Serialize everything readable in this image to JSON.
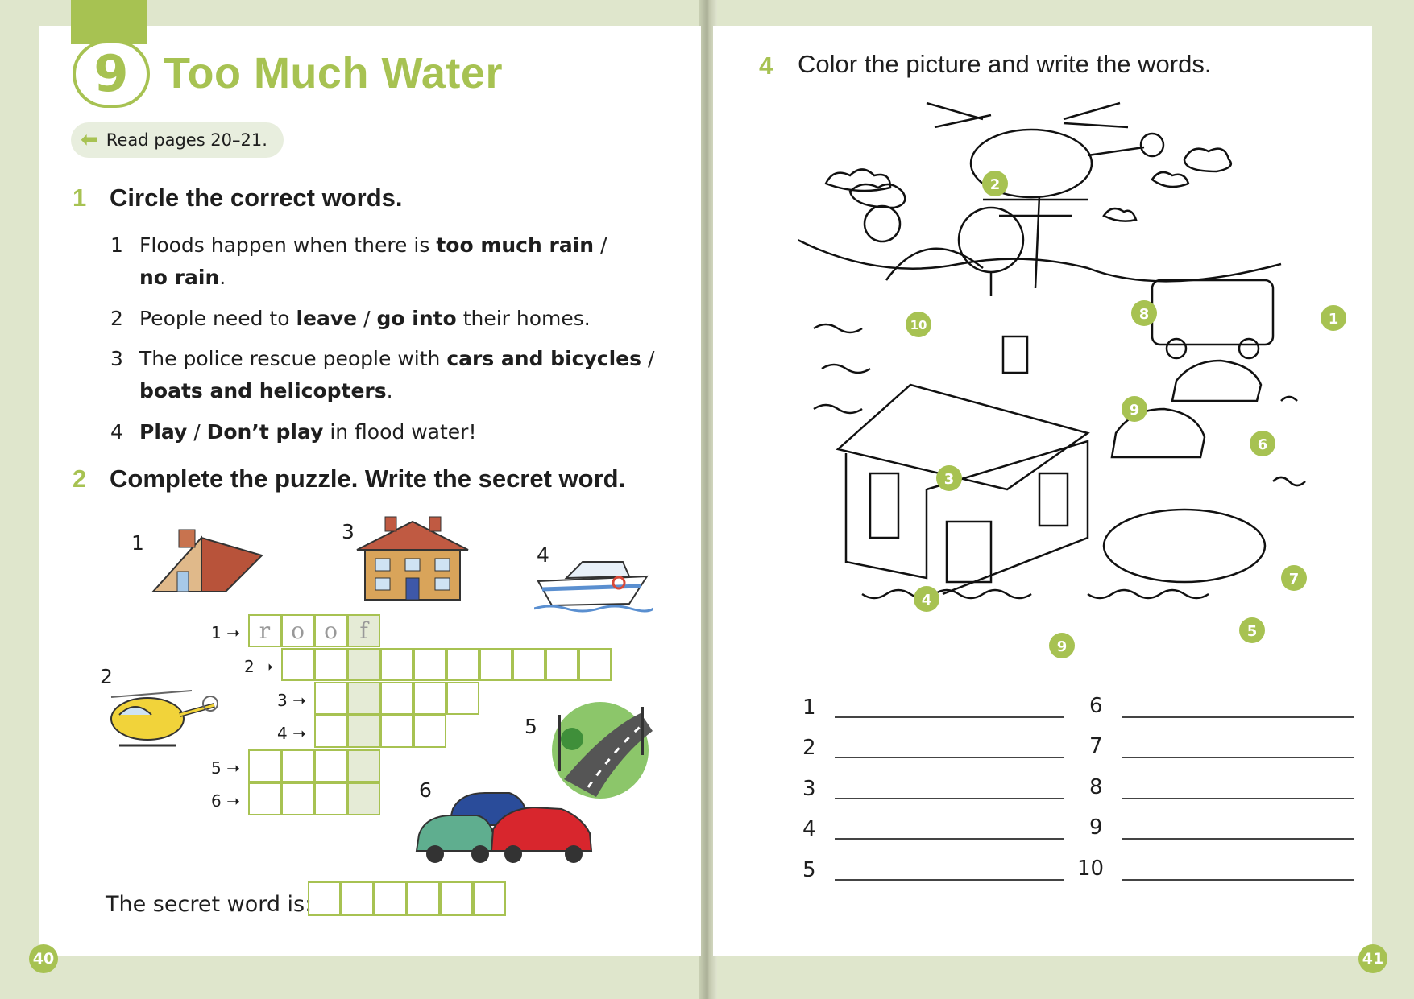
{
  "left": {
    "unit_number": "9",
    "title": "Too Much Water",
    "read_pages": "Read pages 20–21.",
    "page_number": "40",
    "ex1": {
      "number": "1",
      "heading": "Circle the correct words.",
      "items": [
        {
          "n": "1",
          "lines": [
            [
              "Floods happen when there is ",
              "too much rain",
              " /"
            ],
            [
              "",
              "no rain",
              "."
            ]
          ]
        },
        {
          "n": "2",
          "lines": [
            [
              "People need to ",
              "leave",
              " / "
            ],
            [
              "",
              "go into",
              " their homes."
            ]
          ]
        },
        {
          "n": "3",
          "lines": [
            [
              "The police rescue people with ",
              "cars and bicycles",
              " /"
            ],
            [
              "",
              "boats and helicopters",
              "."
            ]
          ]
        },
        {
          "n": "4",
          "lines": [
            [
              "",
              "Play",
              " / "
            ],
            [
              "",
              "Don’t play",
              " in flood water!"
            ]
          ]
        }
      ]
    },
    "ex2": {
      "number": "2",
      "heading": "Complete the puzzle. Write the secret word.",
      "picture_labels": [
        "1",
        "2",
        "3",
        "4",
        "5",
        "6"
      ],
      "row_labels": [
        "1",
        "2",
        "3",
        "4",
        "5",
        "6"
      ],
      "example_letters": [
        "r",
        "o",
        "o",
        "f"
      ],
      "secret_label": "The secret word is:"
    }
  },
  "right": {
    "ex4": {
      "number": "4",
      "heading": "Color the picture and write the words."
    },
    "picture_markers": [
      "1",
      "2",
      "3",
      "4",
      "5",
      "6",
      "7",
      "8",
      "9",
      "9",
      "10"
    ],
    "write_numbers_left": [
      "1",
      "2",
      "3",
      "4",
      "5"
    ],
    "write_numbers_right": [
      "6",
      "7",
      "8",
      "9",
      "10"
    ],
    "page_number": "41"
  },
  "colors": {
    "accent": "#a7c252",
    "highlight": "#e5ebd6",
    "ink": "#1e1e1e"
  },
  "icons": [
    "back-arrow-icon",
    "house-roof-icon",
    "helicopter-icon",
    "house-icon",
    "boat-icon",
    "road-icon",
    "cars-icon",
    "flood-scene-illustration"
  ]
}
